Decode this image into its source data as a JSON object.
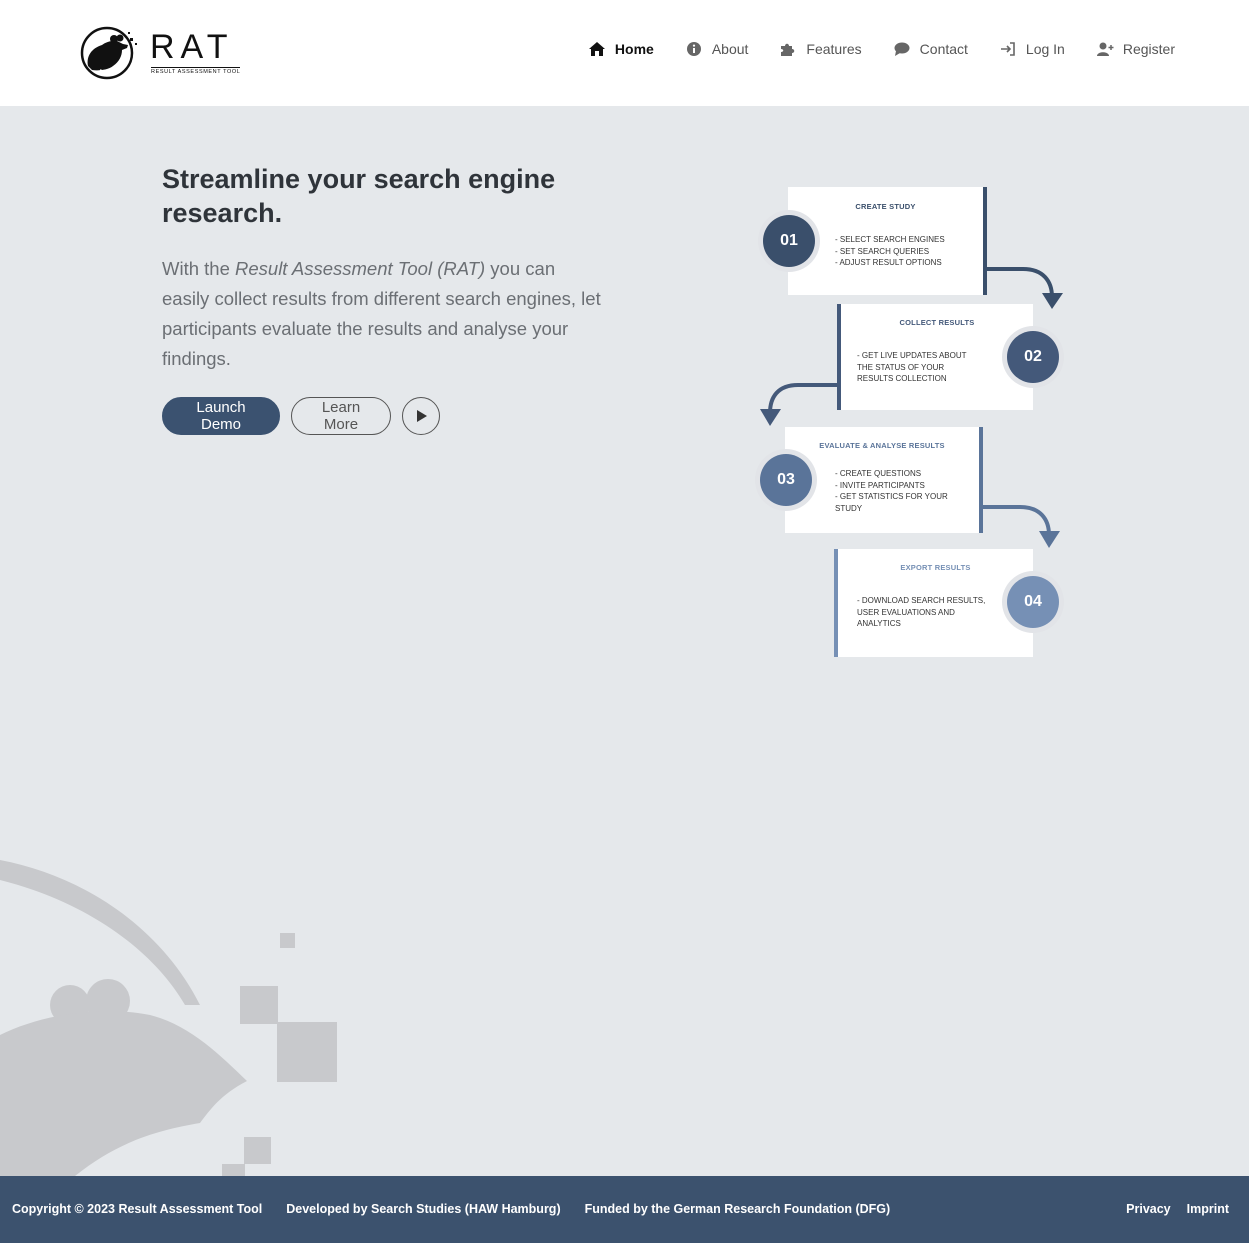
{
  "brand": {
    "name": "RAT",
    "tagline": "RESULT ASSESSMENT TOOL"
  },
  "nav": [
    {
      "label": "Home",
      "icon": "home-icon"
    },
    {
      "label": "About",
      "icon": "info-icon"
    },
    {
      "label": "Features",
      "icon": "puzzle-icon"
    },
    {
      "label": "Contact",
      "icon": "comment-icon"
    },
    {
      "label": "Log In",
      "icon": "login-icon"
    },
    {
      "label": "Register",
      "icon": "user-plus-icon"
    }
  ],
  "hero": {
    "title": "Streamline your search engine research.",
    "desc_prefix": "With the ",
    "desc_emphasis": "Result Assessment Tool (RAT)",
    "desc_suffix": " you can easily collect results from different search engines, let participants evaluate the results and analyse your findings.",
    "launch_label": "Launch Demo",
    "learn_label": "Learn More",
    "play_icon": "play-icon"
  },
  "steps": [
    {
      "num": "01",
      "title": "CREATE STUDY",
      "lines": [
        "- SELECT SEARCH ENGINES",
        "- SET SEARCH QUERIES",
        "- ADJUST RESULT OPTIONS"
      ]
    },
    {
      "num": "02",
      "title": "COLLECT RESULTS",
      "lines": [
        "- GET LIVE UPDATES ABOUT",
        "THE STATUS OF YOUR",
        "RESULTS COLLECTION"
      ]
    },
    {
      "num": "03",
      "title": "EVALUATE & ANALYSE RESULTS",
      "lines": [
        "- CREATE QUESTIONS",
        "- INVITE PARTICIPANTS",
        "- GET STATISTICS FOR YOUR",
        "STUDY"
      ]
    },
    {
      "num": "04",
      "title": "EXPORT RESULTS",
      "lines": [
        "- DOWNLOAD SEARCH RESULTS,",
        "USER EVALUATIONS AND",
        "ANALYTICS"
      ]
    }
  ],
  "colors": {
    "step1": "#3a4f6b",
    "step2": "#44597a",
    "step3": "#5a7499",
    "step4": "#7690b5",
    "footer": "#3c526e"
  },
  "footer": {
    "copyright": "Copyright © 2023 Result Assessment Tool",
    "developed": "Developed by Search Studies (HAW Hamburg)",
    "funded": "Funded by the German Research Foundation (DFG)",
    "privacy": "Privacy",
    "imprint": "Imprint"
  }
}
